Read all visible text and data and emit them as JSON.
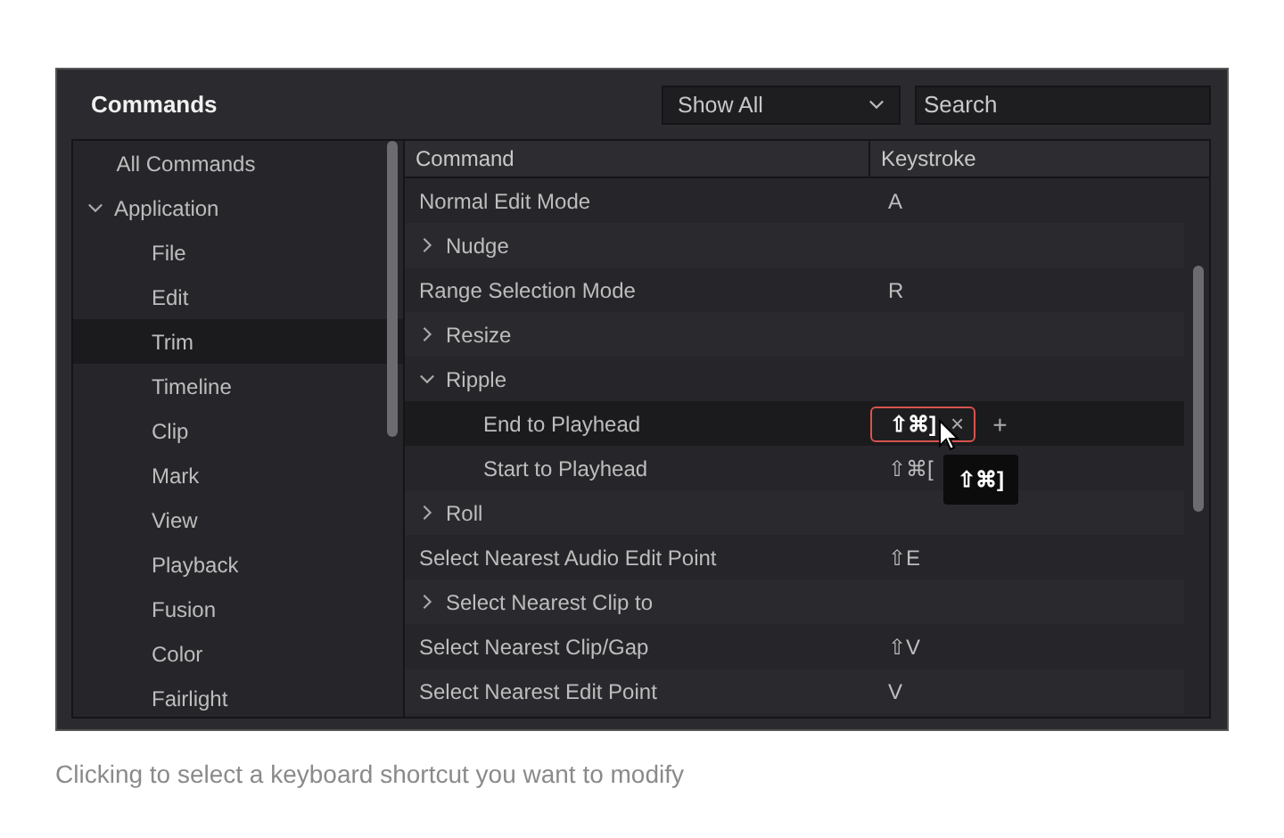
{
  "window": {
    "title": "Commands"
  },
  "filter": {
    "value": "Show All"
  },
  "search": {
    "placeholder": "Search"
  },
  "sidebar": {
    "items": [
      {
        "label": "All Commands",
        "selected": false
      },
      {
        "label": "Application",
        "selected": false,
        "expanded": true,
        "children": [
          {
            "label": "File",
            "selected": false
          },
          {
            "label": "Edit",
            "selected": false
          },
          {
            "label": "Trim",
            "selected": true
          },
          {
            "label": "Timeline",
            "selected": false
          },
          {
            "label": "Clip",
            "selected": false
          },
          {
            "label": "Mark",
            "selected": false
          },
          {
            "label": "View",
            "selected": false
          },
          {
            "label": "Playback",
            "selected": false
          },
          {
            "label": "Fusion",
            "selected": false
          },
          {
            "label": "Color",
            "selected": false
          },
          {
            "label": "Fairlight",
            "selected": false
          }
        ]
      }
    ]
  },
  "table": {
    "columns": [
      "Command",
      "Keystroke"
    ],
    "rows": [
      {
        "command": "Normal Edit Mode",
        "keystroke": "A",
        "selected": false
      },
      {
        "command": "Nudge",
        "expanded": false,
        "selected": false
      },
      {
        "command": "Range Selection Mode",
        "keystroke": "R",
        "selected": false
      },
      {
        "command": "Resize",
        "expanded": false,
        "selected": false
      },
      {
        "command": "Ripple",
        "expanded": true,
        "selected": false,
        "children": [
          {
            "command": "End to Playhead",
            "keystroke": "⇧⌘]",
            "editing": true,
            "selected": true
          },
          {
            "command": "Start to Playhead",
            "keystroke": "⇧⌘[",
            "selected": false
          }
        ]
      },
      {
        "command": "Roll",
        "expanded": false,
        "selected": false
      },
      {
        "command": "Select Nearest Audio Edit Point",
        "keystroke": "⇧E",
        "selected": false
      },
      {
        "command": "Select Nearest Clip to",
        "expanded": false,
        "selected": false
      },
      {
        "command": "Select Nearest Clip/Gap",
        "keystroke": "⇧V",
        "selected": false
      },
      {
        "command": "Select Nearest Edit Point",
        "keystroke": "V",
        "selected": false
      }
    ]
  },
  "edit_chip": {
    "remove": "×",
    "add": "+"
  },
  "tooltip": {
    "text": "⇧⌘]"
  },
  "caption": "Clicking to select a keyboard shortcut you want to modify"
}
